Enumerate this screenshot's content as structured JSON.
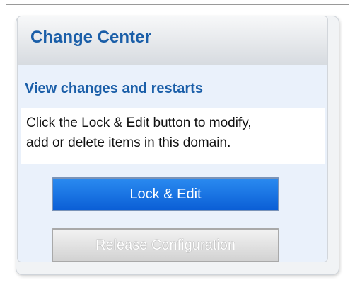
{
  "panel": {
    "title": "Change Center"
  },
  "body": {
    "view_link": "View changes and restarts",
    "message_line1": "Click the Lock & Edit button to modify,",
    "message_line2": "add or delete items in this domain."
  },
  "buttons": {
    "lock_edit_label": "Lock & Edit",
    "release_label": "Release Configuration"
  },
  "colors": {
    "title_blue": "#1a5ea8",
    "primary_button": "#0b5fd6",
    "disabled_button": "#d2d2d2"
  }
}
